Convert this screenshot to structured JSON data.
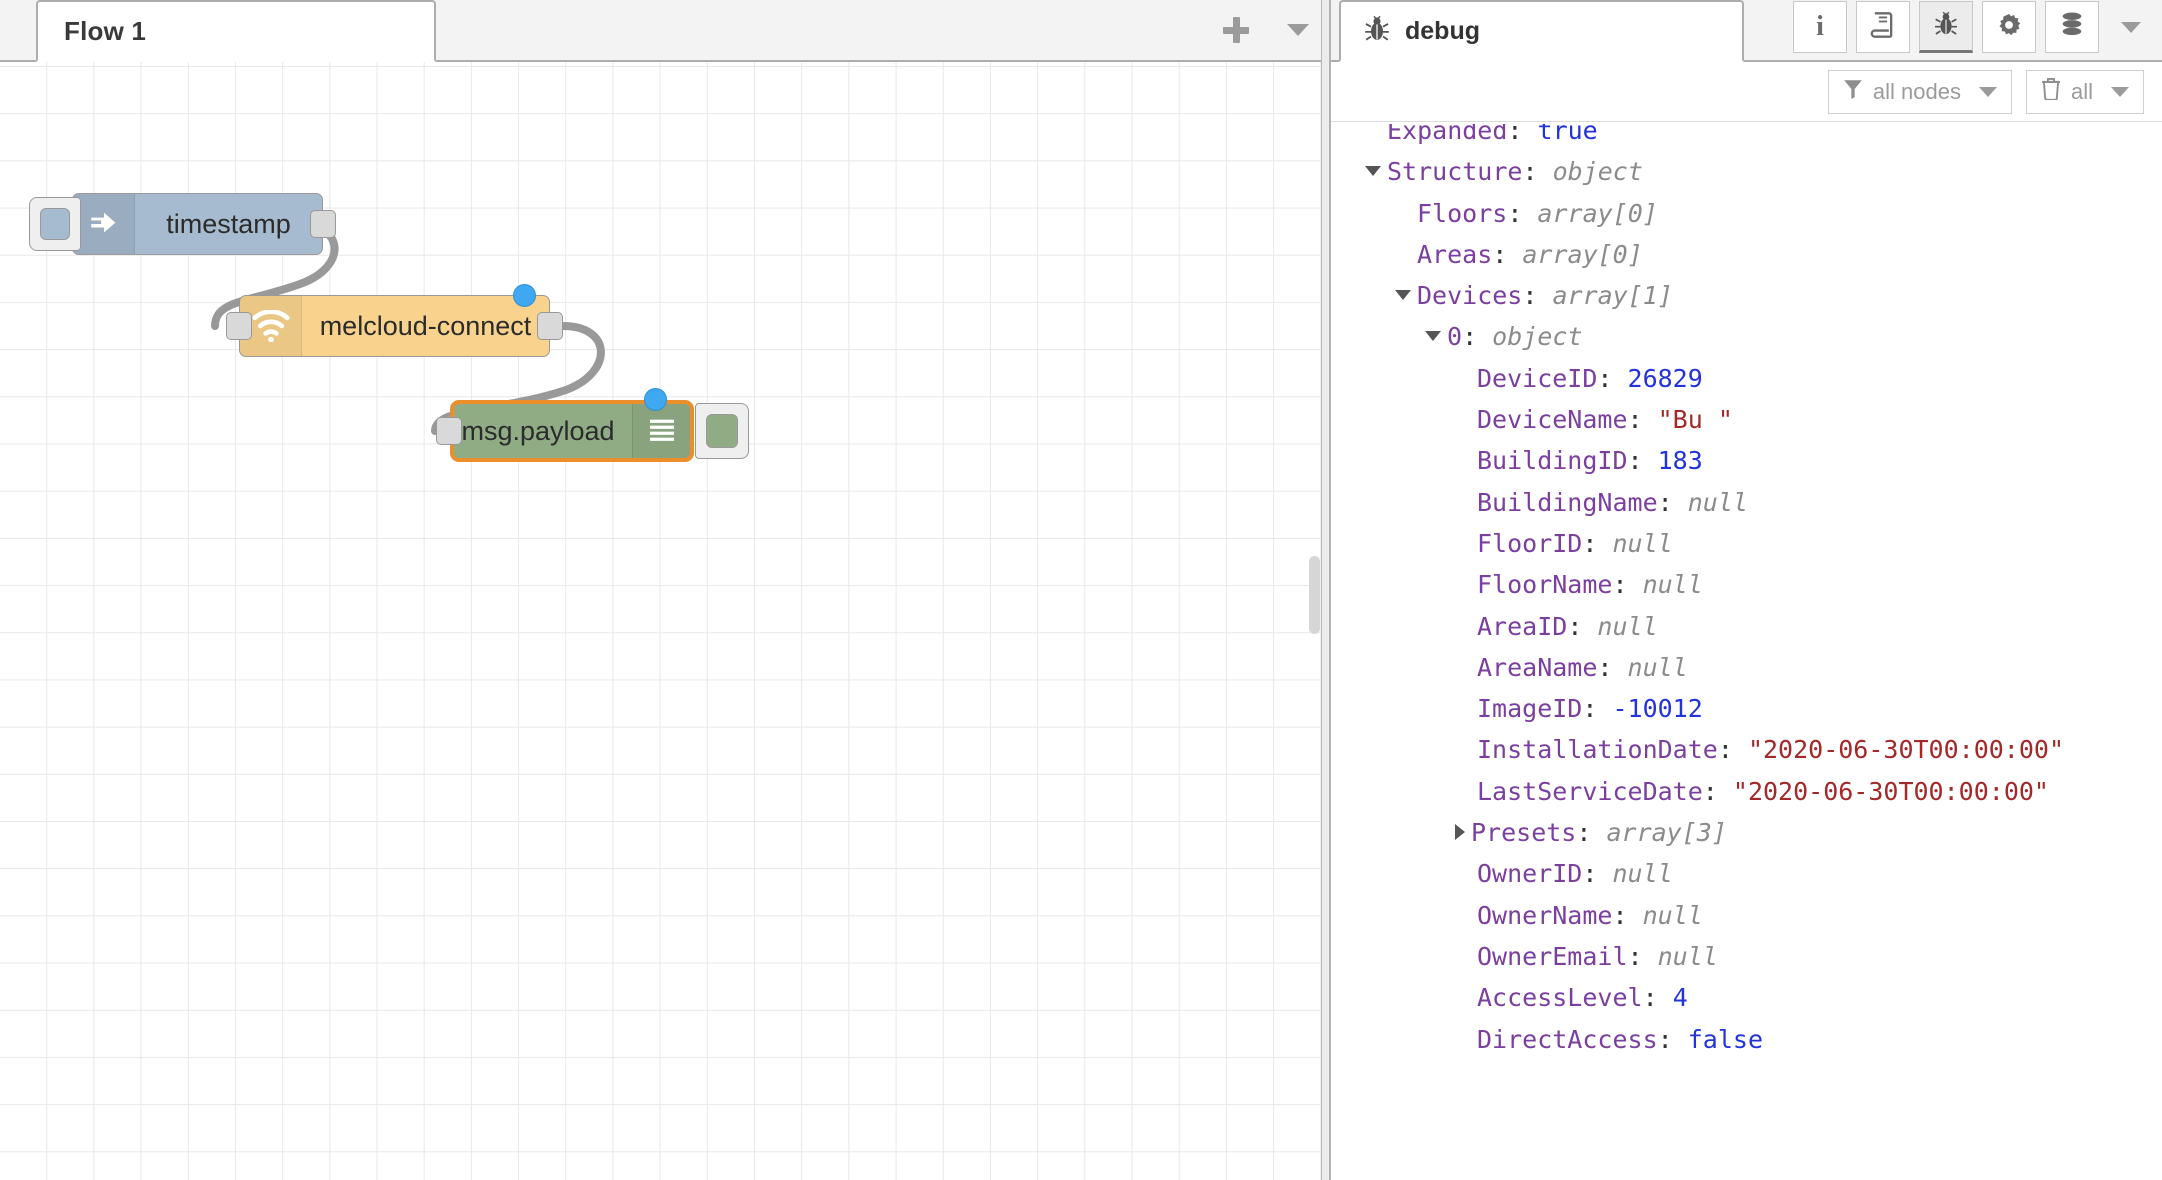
{
  "editor": {
    "tabs": [
      {
        "label": "Flow 1",
        "active": true
      }
    ],
    "add_tab_label": "+",
    "tab_menu_label": "▼",
    "nodes": [
      {
        "id": "inject",
        "label": "timestamp",
        "type": "inject",
        "color": "#a6bbcf",
        "icon": "arrow-right-icon",
        "has_input_button": true,
        "outputs": 1,
        "selected": false
      },
      {
        "id": "melcloud",
        "label": "melcloud-connect",
        "type": "melcloud-connect",
        "color": "#f9d38d",
        "icon": "wifi-icon",
        "inputs": 1,
        "outputs": 1,
        "status_dot_color": "#3fa8f0",
        "selected": false
      },
      {
        "id": "debug",
        "label": "msg.payload",
        "type": "debug",
        "color": "#90ac85",
        "icon": "debug-lines-icon",
        "inputs": 1,
        "outputs": 0,
        "status_dot_color": "#3fa8f0",
        "selected": true,
        "selection_color": "#ea8f2c"
      }
    ]
  },
  "sidebar": {
    "tab": {
      "label": "debug",
      "icon": "bug-icon"
    },
    "tools": [
      {
        "name": "info-icon",
        "label": "i",
        "active": false
      },
      {
        "name": "library-book-icon",
        "label": "",
        "active": false
      },
      {
        "name": "bug-icon",
        "label": "",
        "active": true
      },
      {
        "name": "gear-icon",
        "label": "",
        "active": false
      },
      {
        "name": "context-database-icon",
        "label": "",
        "active": false
      }
    ],
    "expand_caret": "▼",
    "filters": {
      "nodes_filter_label": "all nodes",
      "nodes_filter_icon": "funnel-icon",
      "clear_label": "all",
      "clear_icon": "trash-icon",
      "caret": "▼"
    },
    "debug_tree": [
      {
        "indent": 1,
        "twisty": "none",
        "key": "Expanded",
        "value": "true",
        "vclass": "v-bool",
        "clipped": true
      },
      {
        "indent": 1,
        "twisty": "expanded",
        "key": "Structure",
        "value": "object",
        "vclass": "v-type"
      },
      {
        "indent": 2,
        "twisty": "none",
        "key": "Floors",
        "value": "array[0]",
        "vclass": "v-type"
      },
      {
        "indent": 2,
        "twisty": "none",
        "key": "Areas",
        "value": "array[0]",
        "vclass": "v-type"
      },
      {
        "indent": 2,
        "twisty": "expanded",
        "key": "Devices",
        "value": "array[1]",
        "vclass": "v-type"
      },
      {
        "indent": 3,
        "twisty": "expanded",
        "key": "0",
        "value": "object",
        "vclass": "v-type"
      },
      {
        "indent": 4,
        "twisty": "none",
        "key": "DeviceID",
        "value": "26829",
        "vclass": "v-num"
      },
      {
        "indent": 4,
        "twisty": "none",
        "key": "DeviceName",
        "value": "\"Bu                                      \"",
        "vclass": "v-str"
      },
      {
        "indent": 4,
        "twisty": "none",
        "key": "BuildingID",
        "value": "183",
        "vclass": "v-num"
      },
      {
        "indent": 4,
        "twisty": "none",
        "key": "BuildingName",
        "value": "null",
        "vclass": "v-null"
      },
      {
        "indent": 4,
        "twisty": "none",
        "key": "FloorID",
        "value": "null",
        "vclass": "v-null"
      },
      {
        "indent": 4,
        "twisty": "none",
        "key": "FloorName",
        "value": "null",
        "vclass": "v-null"
      },
      {
        "indent": 4,
        "twisty": "none",
        "key": "AreaID",
        "value": "null",
        "vclass": "v-null"
      },
      {
        "indent": 4,
        "twisty": "none",
        "key": "AreaName",
        "value": "null",
        "vclass": "v-null"
      },
      {
        "indent": 4,
        "twisty": "none",
        "key": "ImageID",
        "value": "-10012",
        "vclass": "v-num"
      },
      {
        "indent": 4,
        "twisty": "none",
        "key": "InstallationDate",
        "value": "\"2020-06-30T00:00:00\"",
        "vclass": "v-str"
      },
      {
        "indent": 4,
        "twisty": "none",
        "key": "LastServiceDate",
        "value": "\"2020-06-30T00:00:00\"",
        "vclass": "v-str"
      },
      {
        "indent": 4,
        "twisty": "collapsed",
        "key": "Presets",
        "value": "array[3]",
        "vclass": "v-type"
      },
      {
        "indent": 4,
        "twisty": "none",
        "key": "OwnerID",
        "value": "null",
        "vclass": "v-null"
      },
      {
        "indent": 4,
        "twisty": "none",
        "key": "OwnerName",
        "value": "null",
        "vclass": "v-null"
      },
      {
        "indent": 4,
        "twisty": "none",
        "key": "OwnerEmail",
        "value": "null",
        "vclass": "v-null"
      },
      {
        "indent": 4,
        "twisty": "none",
        "key": "AccessLevel",
        "value": "4",
        "vclass": "v-num"
      },
      {
        "indent": 4,
        "twisty": "none",
        "key": "DirectAccess",
        "value": "false",
        "vclass": "v-bool"
      }
    ]
  }
}
